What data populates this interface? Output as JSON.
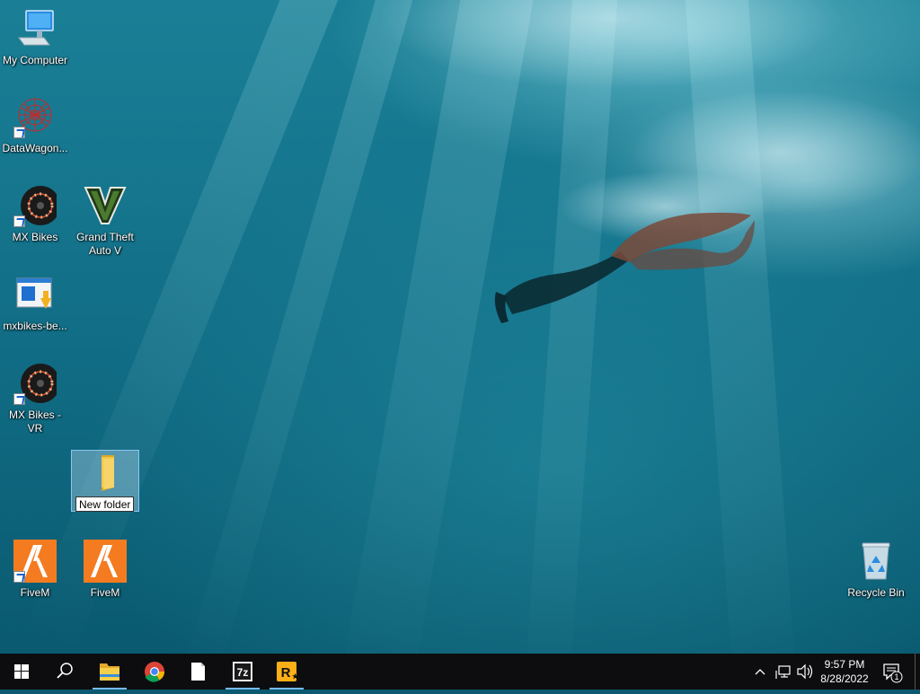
{
  "desktop": {
    "icons": [
      {
        "label": "My Computer",
        "icon": "computer-icon"
      },
      {
        "label": "DataWagon...",
        "icon": "datawagon-icon"
      },
      {
        "label": "MX Bikes",
        "icon": "mx-bikes-icon"
      },
      {
        "label": "Grand Theft Auto V",
        "icon": "gta-v-icon"
      },
      {
        "label": "mxbikes-be...",
        "icon": "installer-icon"
      },
      {
        "label": "MX Bikes - VR",
        "icon": "mx-bikes-vr-icon"
      },
      {
        "label": "New folder",
        "icon": "folder-icon",
        "state": "renaming"
      },
      {
        "label": "FiveM",
        "icon": "fivem-icon"
      },
      {
        "label": "FiveM",
        "icon": "fivem-icon"
      },
      {
        "label": "Recycle Bin",
        "icon": "recycle-bin-icon"
      }
    ]
  },
  "taskbar": {
    "apps": [
      {
        "name": "start-button",
        "icon": "windows-logo-icon"
      },
      {
        "name": "search-button",
        "icon": "search-icon"
      },
      {
        "name": "file-explorer",
        "icon": "folder-icon",
        "running": true
      },
      {
        "name": "chrome",
        "icon": "chrome-icon"
      },
      {
        "name": "notepad",
        "icon": "document-icon"
      },
      {
        "name": "7zip",
        "icon": "7zip-icon",
        "text": "7z",
        "running": true
      },
      {
        "name": "rockstar-launcher",
        "icon": "rockstar-icon",
        "text": "R",
        "running": true
      }
    ],
    "tray": {
      "time": "9:57 PM",
      "date": "8/28/2022",
      "notification_count": "1"
    }
  },
  "colors": {
    "taskbar": "#0d0d0f",
    "accent": "#76b9ed",
    "fivem": "#f47b20",
    "folder": "#f3c845",
    "rockstar": "#fcaf17"
  }
}
